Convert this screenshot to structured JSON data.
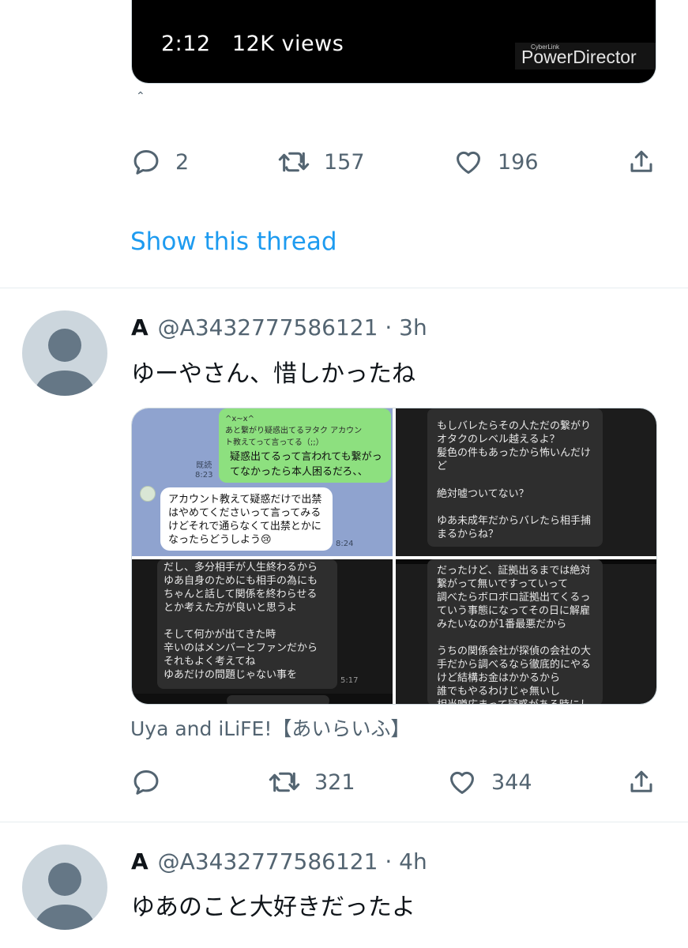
{
  "video": {
    "duration": "2:12",
    "views": "12K views",
    "watermark_small": "CyberLink",
    "watermark": "PowerDirector"
  },
  "tweet0": {
    "actions": {
      "replies": "2",
      "retweets": "157",
      "likes": "196"
    },
    "show_thread": "Show this thread"
  },
  "tweet1": {
    "name": "A",
    "handle": "@A3432777586121",
    "sep": "·",
    "time": "3h",
    "text": "ゆーやさん、惜しかったね",
    "media": {
      "c1_top": "^x~x^\nあと繋がり疑惑出てるヲタク アカウン\nト教えてって言ってる（;;）",
      "c1_main": "疑惑出てるって言われても繋がっ\nてなかったら本人困るだろ、、",
      "c1_read": "既読\n8:23",
      "c1_reply": "アカウント教えて疑惑だけで出禁\nはやめてくださいって言ってみる\nけどそれで通らなくて出禁とかに\nなったらどうしよう😢",
      "c1_time": "8:24",
      "c2_text1": "もしバレたらその人ただの繋がり\nオタクのレベル越えるよ？\n髪色の件もあったから怖いんだけ\nど",
      "c2_text2": "絶対嘘ついてない？",
      "c2_text3": "ゆあ未成年だからバレたら相手捕\nまるからね？",
      "c3_text": "だし、多分相手が人生終わるから\nゆあ自身のためにも相手の為にも\nちゃんと話して関係を終わらせる\nとか考えた方が良いと思うよ\n\nそして何かが出てきた時\n辛いのはメンバーとファンだから\nそれもよく考えてね\nゆあだけの問題じゃない事を",
      "c3_time": "5:17",
      "c4_text": "だったけど、証拠出るまでは絶対\n繋がって無いですっていって\n調べたらボロボロ証拠出てくるっ\nていう事態になってその日に解雇\nみたいなのが1番最悪だから\n\nうちの関係会社が探偵の会社の大\n手だから調べるなら徹底的にやる\nけど結構お金はかかるから\n誰でもやるわけじゃ無いし\n相当噂広まって疑惑がある時にし"
    },
    "source": "Uya and iLiFE!【あいらいふ】",
    "actions": {
      "replies": "",
      "retweets": "321",
      "likes": "344"
    }
  },
  "tweet2": {
    "name": "A",
    "handle": "@A3432777586121",
    "sep": "·",
    "time": "4h",
    "text": "ゆあのこと大好きだったよ"
  },
  "colors": {
    "link": "#1d9bf0",
    "secondary_text": "#536471",
    "divider": "#e6ecf0",
    "avatar_bg": "#ccd6dd"
  },
  "icons": [
    "reply-icon",
    "retweet-icon",
    "like-icon",
    "share-icon",
    "default-avatar-icon"
  ]
}
